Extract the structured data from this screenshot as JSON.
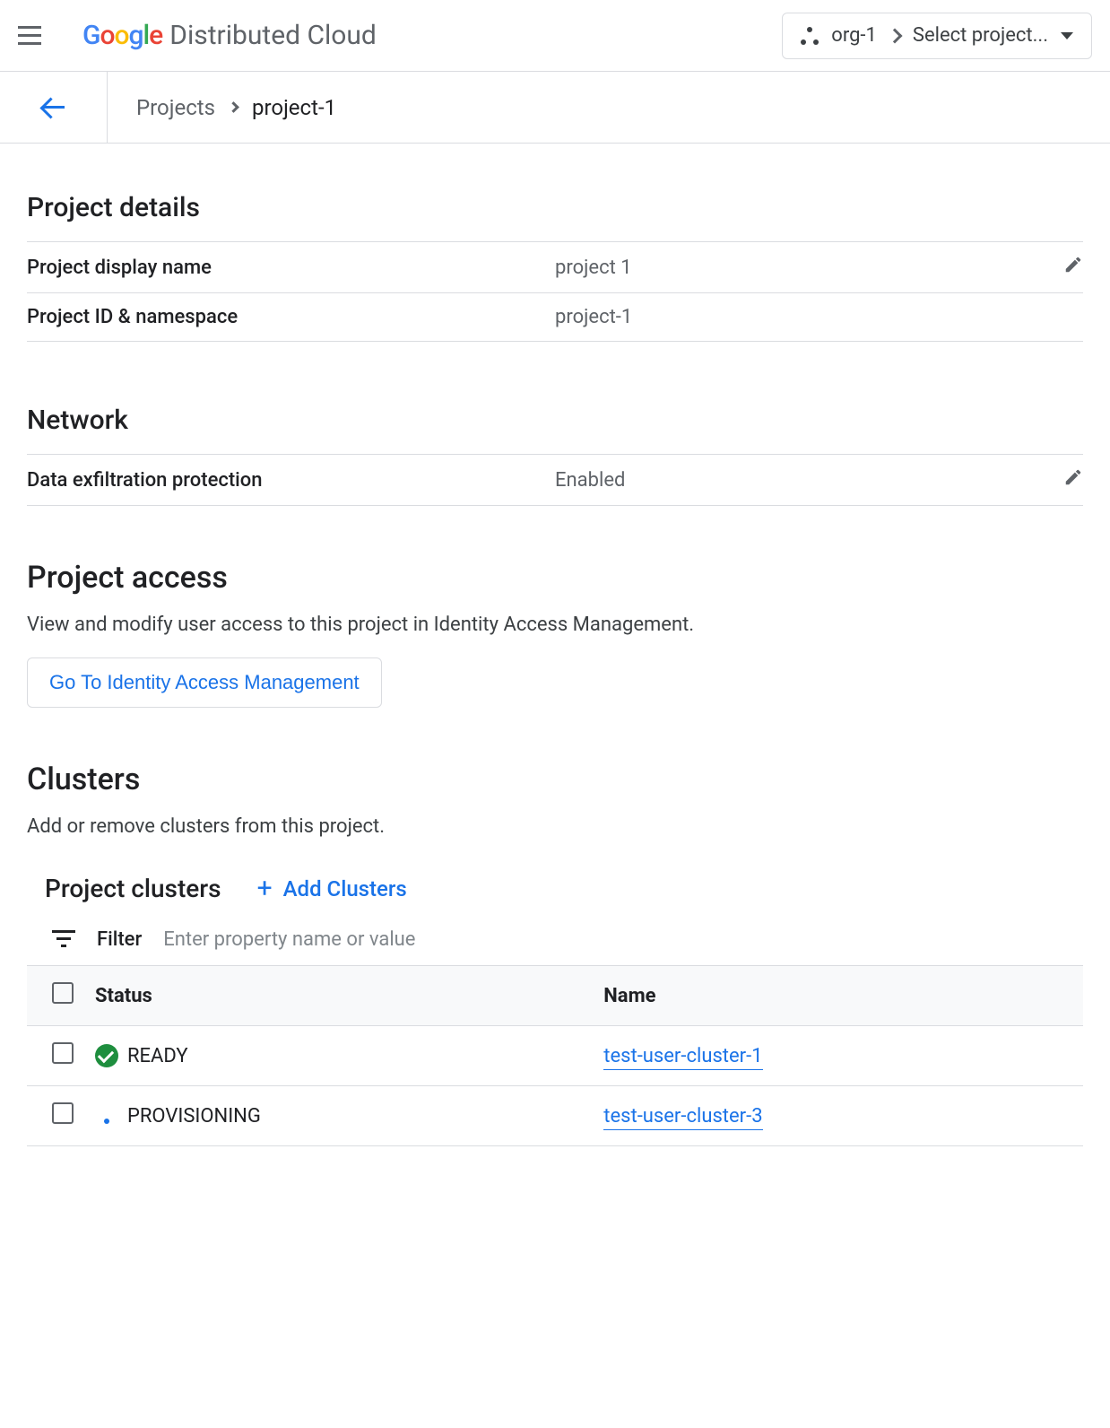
{
  "header": {
    "product": "Distributed Cloud",
    "org": "org-1",
    "project_selector": "Select project..."
  },
  "breadcrumb": {
    "parent": "Projects",
    "current": "project-1"
  },
  "project_details": {
    "title": "Project details",
    "rows": [
      {
        "label": "Project display name",
        "value": "project 1",
        "editable": true
      },
      {
        "label": "Project ID & namespace",
        "value": "project-1",
        "editable": false
      }
    ]
  },
  "network": {
    "title": "Network",
    "rows": [
      {
        "label": "Data exfiltration protection",
        "value": "Enabled",
        "editable": true
      }
    ]
  },
  "access": {
    "title": "Project access",
    "description": "View and modify user access to this project in Identity Access Management.",
    "button": "Go To Identity Access Management"
  },
  "clusters": {
    "title": "Clusters",
    "description": "Add or remove clusters from this project.",
    "subheader": "Project clusters",
    "add_button": "Add Clusters",
    "filter_label": "Filter",
    "filter_placeholder": "Enter property name or value",
    "columns": {
      "status": "Status",
      "name": "Name"
    },
    "rows": [
      {
        "status": "READY",
        "status_type": "ready",
        "name": "test-user-cluster-1"
      },
      {
        "status": "PROVISIONING",
        "status_type": "provisioning",
        "name": "test-user-cluster-3"
      }
    ]
  }
}
